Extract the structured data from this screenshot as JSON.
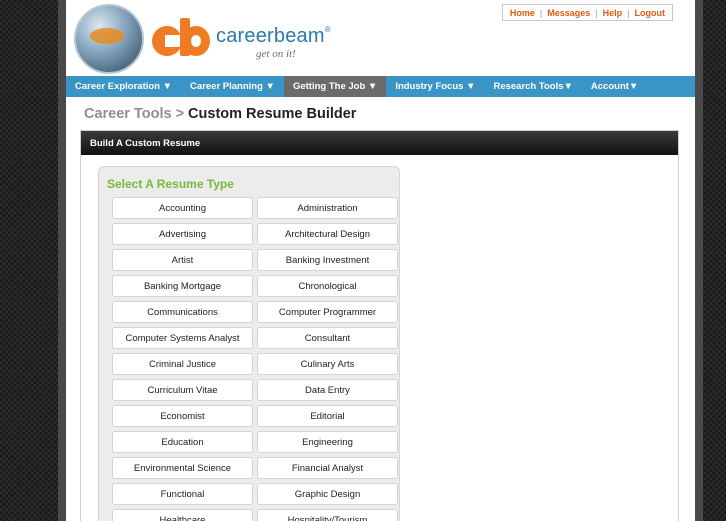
{
  "header": {
    "brand_name": "careerbeam",
    "trademark": "®",
    "tagline": "get on it!",
    "top_links": [
      "Home",
      "Messages",
      "Help",
      "Logout"
    ],
    "separator": "|"
  },
  "nav": {
    "items": [
      {
        "label": "Career Exploration ▼"
      },
      {
        "label": "Career Planning ▼"
      },
      {
        "label": "Getting The Job ▼"
      },
      {
        "label": "Industry Focus ▼"
      },
      {
        "label": "Research Tools▼"
      },
      {
        "label": "Account▼"
      }
    ],
    "active_index": 2
  },
  "breadcrumb": {
    "parent": "Career Tools",
    "separator": ">",
    "current": "Custom Resume Builder"
  },
  "panel": {
    "title": "Build A Custom Resume",
    "section_title": "Select A Resume Type",
    "resume_types": [
      "Accounting",
      "Administration",
      "Advertising",
      "Architectural Design",
      "Artist",
      "Banking Investment",
      "Banking Mortgage",
      "Chronological",
      "Communications",
      "Computer Programmer",
      "Computer Systems Analyst",
      "Consultant",
      "Criminal Justice",
      "Culinary Arts",
      "Curriculum Vitae",
      "Data Entry",
      "Economist",
      "Editorial",
      "Education",
      "Engineering",
      "Environmental Science",
      "Financial Analyst",
      "Functional",
      "Graphic Design",
      "Healthcare",
      "Hospitality/Tourism"
    ]
  },
  "colors": {
    "nav_bg": "#3a95c6",
    "nav_active": "#6b6b6b",
    "accent_orange": "#ef7b23",
    "link_orange": "#e05a10",
    "section_green": "#7ab83a",
    "brand_blue": "#2c79ad"
  }
}
